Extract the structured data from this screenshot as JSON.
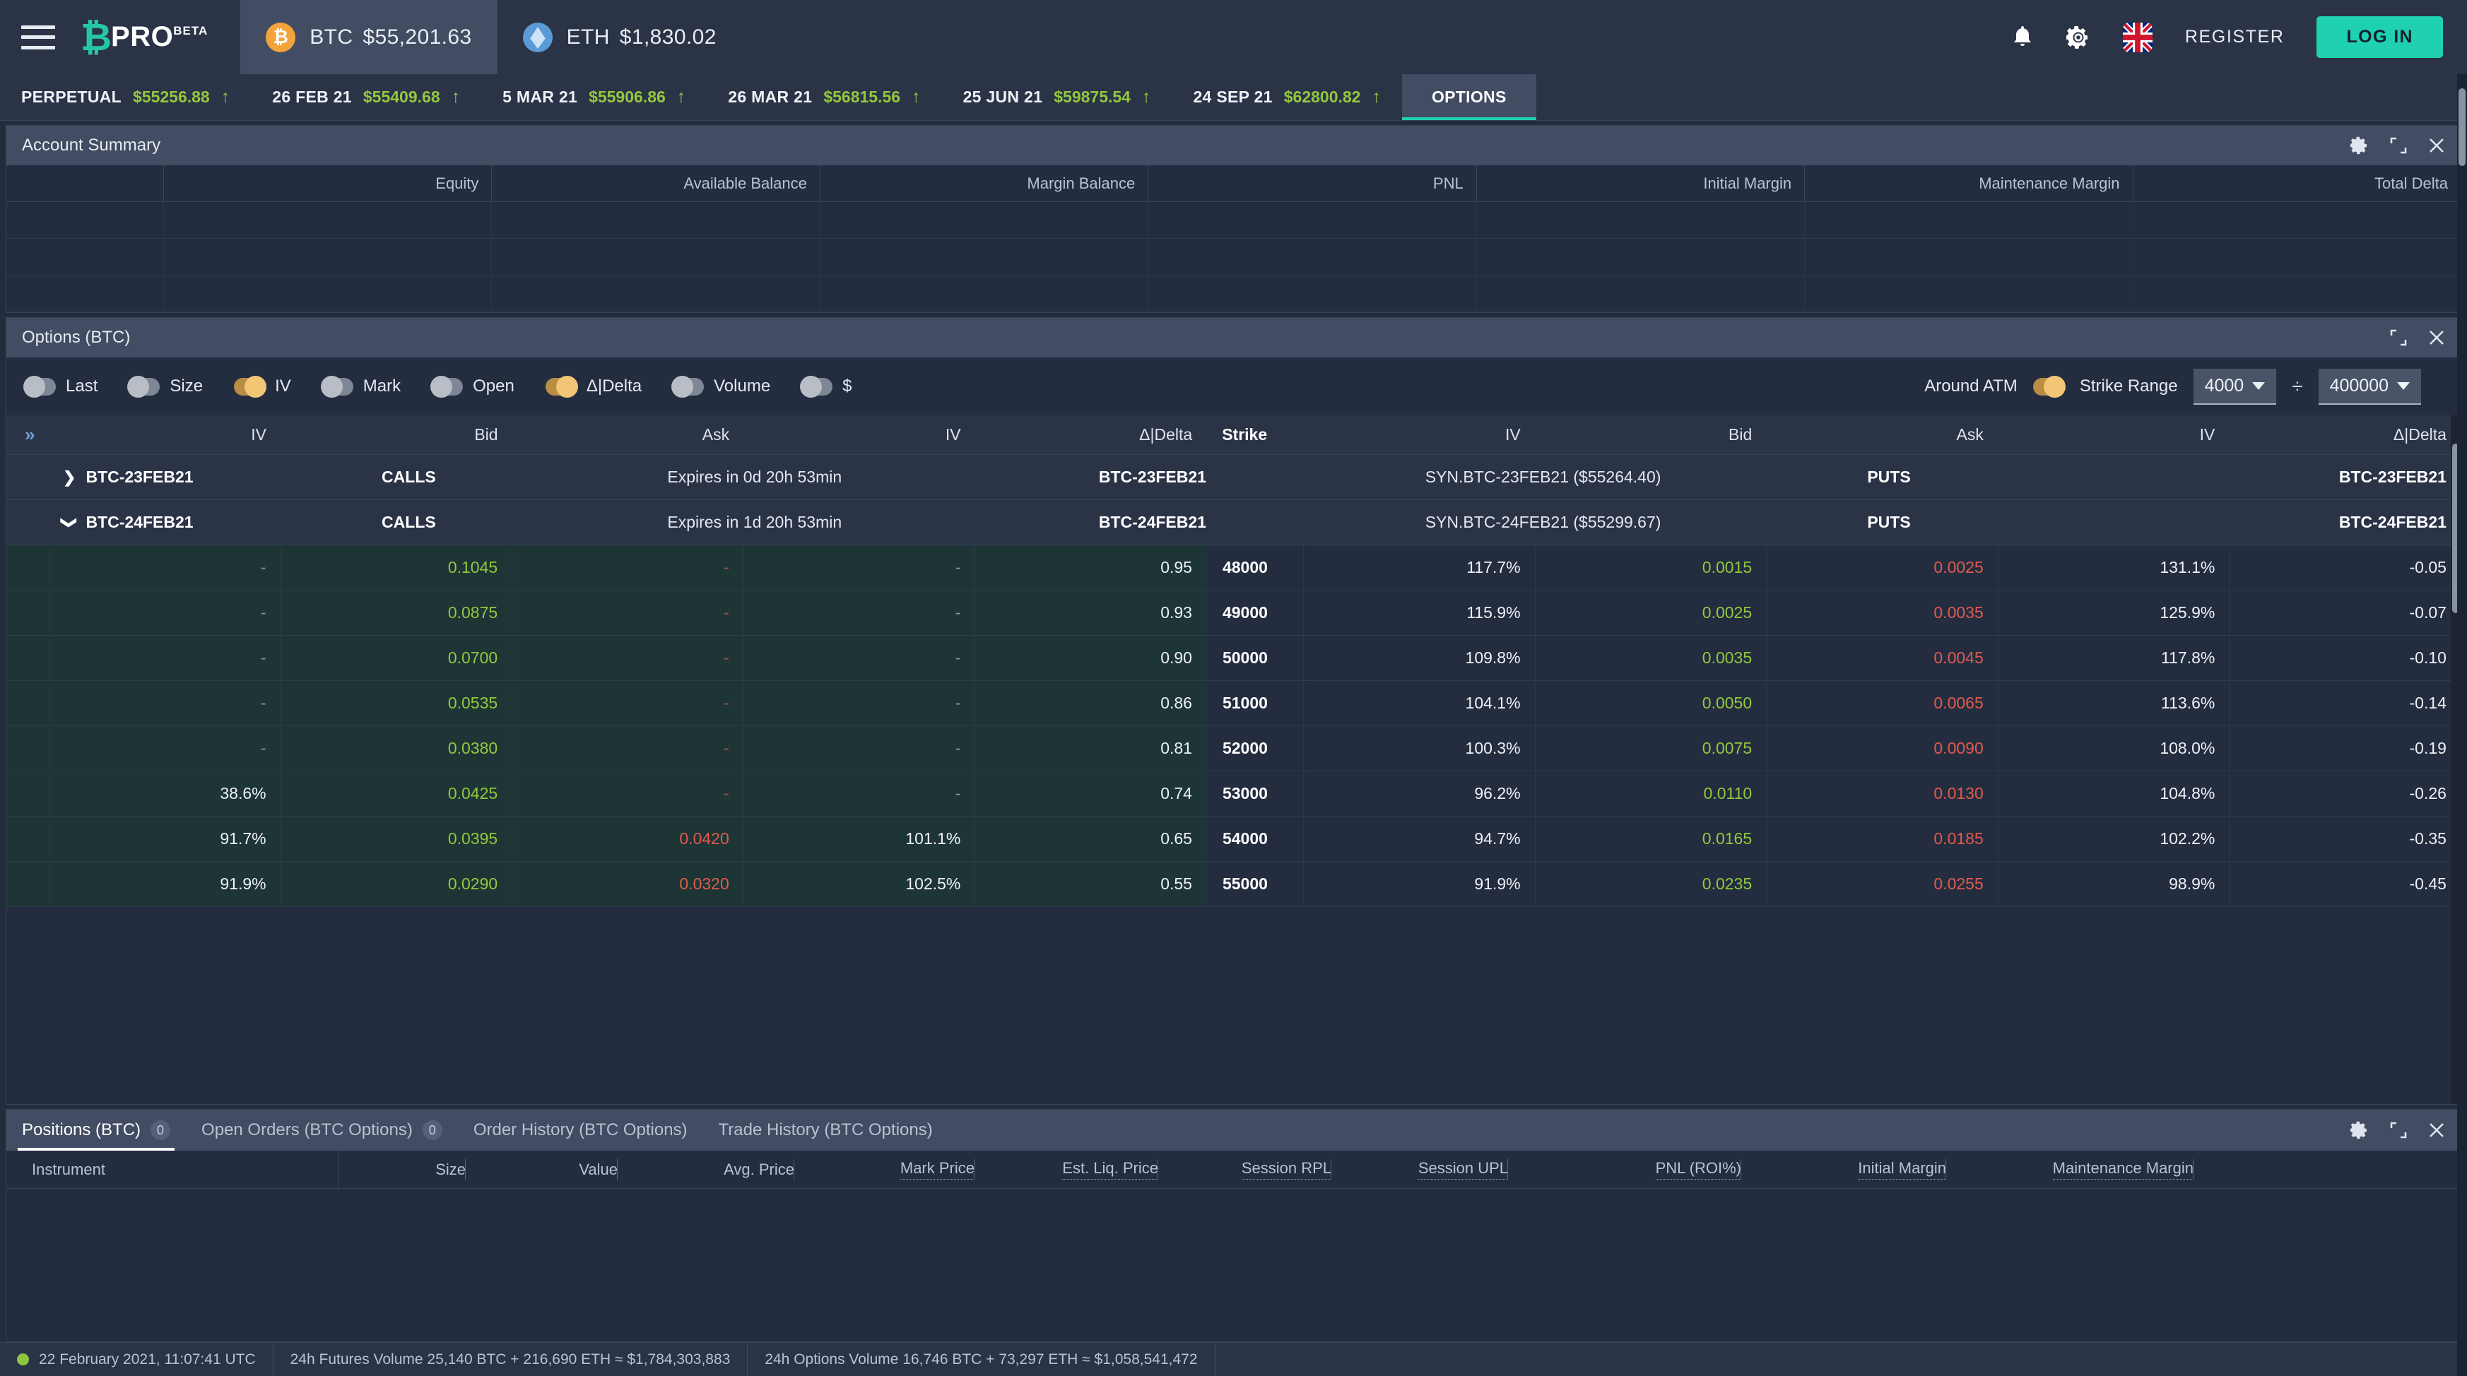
{
  "header": {
    "logo_mark": "₿",
    "logo_text": "PRO",
    "logo_beta": "BETA",
    "tickers": [
      {
        "symbol": "BTC",
        "price": "$55,201.63",
        "icon": "bitcoin-icon",
        "active": true
      },
      {
        "symbol": "ETH",
        "price": "$1,830.02",
        "icon": "ethereum-icon",
        "active": false
      }
    ],
    "bell_icon": "bell-icon",
    "gear_icon": "gear-icon",
    "flag_icon": "uk-flag-icon",
    "register_label": "REGISTER",
    "login_label": "LOG IN"
  },
  "instruments": [
    {
      "name": "PERPETUAL",
      "price": "$55256.88",
      "dir": "up"
    },
    {
      "name": "26 FEB 21",
      "price": "$55409.68",
      "dir": "up"
    },
    {
      "name": "5 MAR 21",
      "price": "$55906.86",
      "dir": "up"
    },
    {
      "name": "26 MAR 21",
      "price": "$56815.56",
      "dir": "up"
    },
    {
      "name": "25 JUN 21",
      "price": "$59875.54",
      "dir": "up"
    },
    {
      "name": "24 SEP 21",
      "price": "$62800.82",
      "dir": "up"
    }
  ],
  "options_tab_label": "OPTIONS",
  "account_summary": {
    "title": "Account Summary",
    "columns": [
      "",
      "Equity",
      "Available Balance",
      "Margin Balance",
      "PNL",
      "Initial Margin",
      "Maintenance Margin",
      "Total Delta"
    ],
    "rows": 4
  },
  "options_panel": {
    "title": "Options (BTC)",
    "toggles": [
      {
        "label": "Last",
        "on": false
      },
      {
        "label": "Size",
        "on": false
      },
      {
        "label": "IV",
        "on": true
      },
      {
        "label": "Mark",
        "on": false
      },
      {
        "label": "Open",
        "on": false
      },
      {
        "label": "Δ|Delta",
        "on": true
      },
      {
        "label": "Volume",
        "on": false
      },
      {
        "label": "$",
        "on": false
      }
    ],
    "around_atm_label": "Around ATM",
    "strike_range_label": "Strike Range",
    "strike_range_on": true,
    "range_min": "4000",
    "range_max": "400000",
    "divider_symbol": "÷",
    "columns": [
      "»",
      "IV",
      "Bid",
      "Ask",
      "IV",
      "Δ|Delta",
      "Strike",
      "IV",
      "Bid",
      "Ask",
      "IV",
      "Δ|Delta"
    ],
    "expiries": [
      {
        "name": "BTC-23FEB21",
        "calls_label": "CALLS",
        "puts_label": "PUTS",
        "expires": "Expires in 0d 20h 53min",
        "syn": "SYN.BTC-23FEB21 ($55264.40)",
        "expanded": false,
        "rows": []
      },
      {
        "name": "BTC-24FEB21",
        "calls_label": "CALLS",
        "puts_label": "PUTS",
        "expires": "Expires in 1d 20h 53min",
        "syn": "SYN.BTC-24FEB21 ($55299.67)",
        "expanded": true,
        "rows": [
          {
            "c_iv1": "-",
            "c_bid": "0.1045",
            "c_ask": "-",
            "c_iv2": "-",
            "c_delta": "0.95",
            "strike": "48000",
            "p_iv1": "117.7%",
            "p_bid": "0.0015",
            "p_ask": "0.0025",
            "p_iv2": "131.1%",
            "p_delta": "-0.05"
          },
          {
            "c_iv1": "-",
            "c_bid": "0.0875",
            "c_ask": "-",
            "c_iv2": "-",
            "c_delta": "0.93",
            "strike": "49000",
            "p_iv1": "115.9%",
            "p_bid": "0.0025",
            "p_ask": "0.0035",
            "p_iv2": "125.9%",
            "p_delta": "-0.07"
          },
          {
            "c_iv1": "-",
            "c_bid": "0.0700",
            "c_ask": "-",
            "c_iv2": "-",
            "c_delta": "0.90",
            "strike": "50000",
            "p_iv1": "109.8%",
            "p_bid": "0.0035",
            "p_ask": "0.0045",
            "p_iv2": "117.8%",
            "p_delta": "-0.10"
          },
          {
            "c_iv1": "-",
            "c_bid": "0.0535",
            "c_ask": "-",
            "c_iv2": "-",
            "c_delta": "0.86",
            "strike": "51000",
            "p_iv1": "104.1%",
            "p_bid": "0.0050",
            "p_ask": "0.0065",
            "p_iv2": "113.6%",
            "p_delta": "-0.14"
          },
          {
            "c_iv1": "-",
            "c_bid": "0.0380",
            "c_ask": "-",
            "c_iv2": "-",
            "c_delta": "0.81",
            "strike": "52000",
            "p_iv1": "100.3%",
            "p_bid": "0.0075",
            "p_ask": "0.0090",
            "p_iv2": "108.0%",
            "p_delta": "-0.19"
          },
          {
            "c_iv1": "38.6%",
            "c_bid": "0.0425",
            "c_ask": "-",
            "c_iv2": "-",
            "c_delta": "0.74",
            "strike": "53000",
            "p_iv1": "96.2%",
            "p_bid": "0.0110",
            "p_ask": "0.0130",
            "p_iv2": "104.8%",
            "p_delta": "-0.26"
          },
          {
            "c_iv1": "91.7%",
            "c_bid": "0.0395",
            "c_ask": "0.0420",
            "c_iv2": "101.1%",
            "c_delta": "0.65",
            "strike": "54000",
            "p_iv1": "94.7%",
            "p_bid": "0.0165",
            "p_ask": "0.0185",
            "p_iv2": "102.2%",
            "p_delta": "-0.35"
          },
          {
            "c_iv1": "91.9%",
            "c_bid": "0.0290",
            "c_ask": "0.0320",
            "c_iv2": "102.5%",
            "c_delta": "0.55",
            "strike": "55000",
            "p_iv1": "91.9%",
            "p_bid": "0.0235",
            "p_ask": "0.0255",
            "p_iv2": "98.9%",
            "p_delta": "-0.45"
          }
        ]
      }
    ]
  },
  "bottom_panel": {
    "tabs": [
      {
        "label": "Positions (BTC)",
        "badge": "0",
        "active": true
      },
      {
        "label": "Open Orders (BTC Options)",
        "badge": "0",
        "active": false
      },
      {
        "label": "Order History (BTC Options)",
        "badge": null,
        "active": false
      },
      {
        "label": "Trade History (BTC Options)",
        "badge": null,
        "active": false
      }
    ],
    "columns": [
      {
        "label": "Instrument",
        "dotted": false
      },
      {
        "label": "Size",
        "dotted": false
      },
      {
        "label": "Value",
        "dotted": false
      },
      {
        "label": "Avg. Price",
        "dotted": false
      },
      {
        "label": "Mark Price",
        "dotted": true
      },
      {
        "label": "Est. Liq. Price",
        "dotted": true
      },
      {
        "label": "Session RPL",
        "dotted": true
      },
      {
        "label": "Session UPL",
        "dotted": true
      },
      {
        "label": "PNL (ROI%)",
        "dotted": true
      },
      {
        "label": "Initial Margin",
        "dotted": true
      },
      {
        "label": "Maintenance Margin",
        "dotted": true
      }
    ]
  },
  "footer": {
    "timestamp": "22 February 2021, 11:07:41 UTC",
    "futures_volume": "24h Futures Volume 25,140 BTC + 216,690 ETH ≈ $1,784,303,883",
    "options_volume": "24h Options Volume 16,746 BTC + 73,297 ETH ≈ $1,058,541,472"
  },
  "colors": {
    "accent": "#1fd1b0",
    "green": "#93c83e",
    "red": "#e05b4e",
    "amber": "#f2c675",
    "panel_head": "#424c63",
    "bg": "#232c3d"
  }
}
